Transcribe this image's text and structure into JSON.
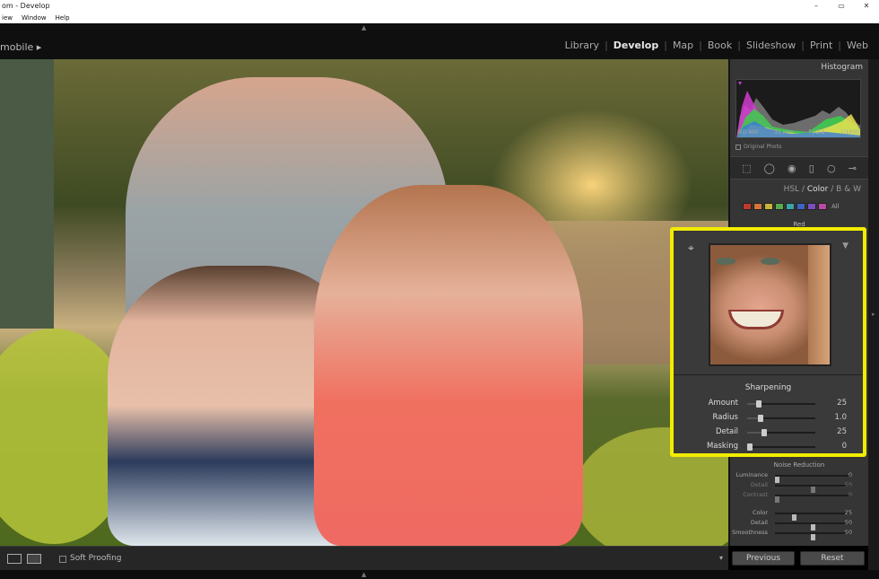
{
  "window": {
    "title": "om - Develop",
    "controls": [
      "–",
      "▭",
      "✕"
    ]
  },
  "menubar": [
    "iew",
    "Window",
    "Help"
  ],
  "identity": {
    "left_text": "mobile ▸"
  },
  "modules": {
    "items": [
      "Library",
      "Develop",
      "Map",
      "Book",
      "Slideshow",
      "Print",
      "Web"
    ],
    "active": "Develop",
    "separator": "|"
  },
  "histogram": {
    "title": "Histogram",
    "readout": {
      "iso": "ISO 400",
      "focal": "35 mm",
      "aperture": "f / 2.8",
      "shutter": "1/1000"
    },
    "original_photo_label": "Original Photo"
  },
  "hsl": {
    "tabs": [
      "HSL",
      "Color",
      "B & W"
    ],
    "separator": "/",
    "active_tab": "Color",
    "swatches": [
      "#c0392b",
      "#d3753c",
      "#c8b33b",
      "#58a94e",
      "#3ba3a6",
      "#3d63c4",
      "#7a4fc0",
      "#b94aa3"
    ],
    "all_label": "All",
    "selected_color_label": "Red"
  },
  "detail": {
    "section_title": "Sharpening",
    "sliders": [
      {
        "label": "Amount",
        "value": "25",
        "pct": 0.17
      },
      {
        "label": "Radius",
        "value": "1.0",
        "pct": 0.2
      },
      {
        "label": "Detail",
        "value": "25",
        "pct": 0.25
      },
      {
        "label": "Masking",
        "value": "0",
        "pct": 0.0
      }
    ]
  },
  "noise": {
    "title": "Noise Reduction",
    "rows": [
      {
        "label": "Luminance",
        "value": "0",
        "pct": 0.0,
        "dim": false
      },
      {
        "label": "Detail",
        "value": "50",
        "pct": 0.5,
        "dim": true
      },
      {
        "label": "Contrast",
        "value": "0",
        "pct": 0.0,
        "dim": true
      },
      {
        "label": "Color",
        "value": "25",
        "pct": 0.25,
        "dim": false
      },
      {
        "label": "Detail",
        "value": "50",
        "pct": 0.5,
        "dim": false
      },
      {
        "label": "Smoothness",
        "value": "50",
        "pct": 0.5,
        "dim": false
      }
    ]
  },
  "toolbar": {
    "soft_proofing_label": "Soft Proofing",
    "dropdown_icon": "▾"
  },
  "buttons": {
    "previous": "Previous",
    "reset": "Reset"
  },
  "colors": {
    "highlight_border": "#f2ec00",
    "panel_bg": "#353535",
    "active_module": "#e6e6e6"
  }
}
